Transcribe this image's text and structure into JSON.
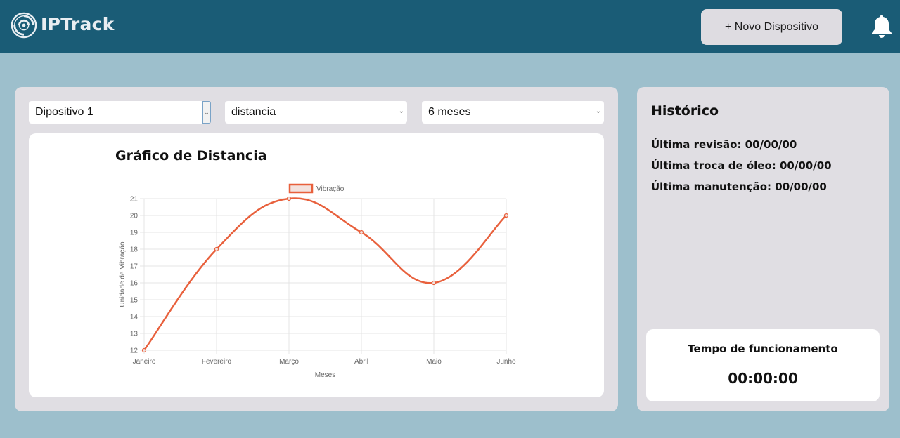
{
  "app": {
    "brand": "IPTrack",
    "logo_icon": "swirl-logo-icon",
    "new_device_label": "+ Novo Dispositivo",
    "bell_icon": "bell-icon"
  },
  "filters": {
    "device": "Dipositivo 1",
    "metric": "distancia",
    "period": "6 meses"
  },
  "chart": {
    "title": "Gráfico de Distancia"
  },
  "chart_data": {
    "type": "line",
    "categories": [
      "Janeiro",
      "Fevereiro",
      "Março",
      "Abril",
      "Maio",
      "Junho"
    ],
    "series": [
      {
        "name": "Vibração",
        "values": [
          12,
          18,
          21,
          19,
          16,
          20
        ]
      }
    ],
    "xlabel": "Meses",
    "ylabel": "Unidade de Vibração",
    "ylim": [
      12,
      21
    ],
    "yticks": [
      12,
      13,
      14,
      15,
      16,
      17,
      18,
      19,
      20,
      21
    ],
    "grid": true,
    "legend": "top-center",
    "color": "#e8603c"
  },
  "history": {
    "title": "Histórico",
    "last_review": "Última revisão: 00/00/00",
    "last_oil_change": "Última troca de óleo: 00/00/00",
    "last_maintenance": "Última manutenção: 00/00/00"
  },
  "uptime": {
    "label": "Tempo de funcionamento",
    "value": "00:00:00"
  },
  "colors": {
    "topbar": "#1a5c76",
    "background": "#9dbfcc",
    "panel": "#e0dee3",
    "accent_line": "#e8603c"
  }
}
